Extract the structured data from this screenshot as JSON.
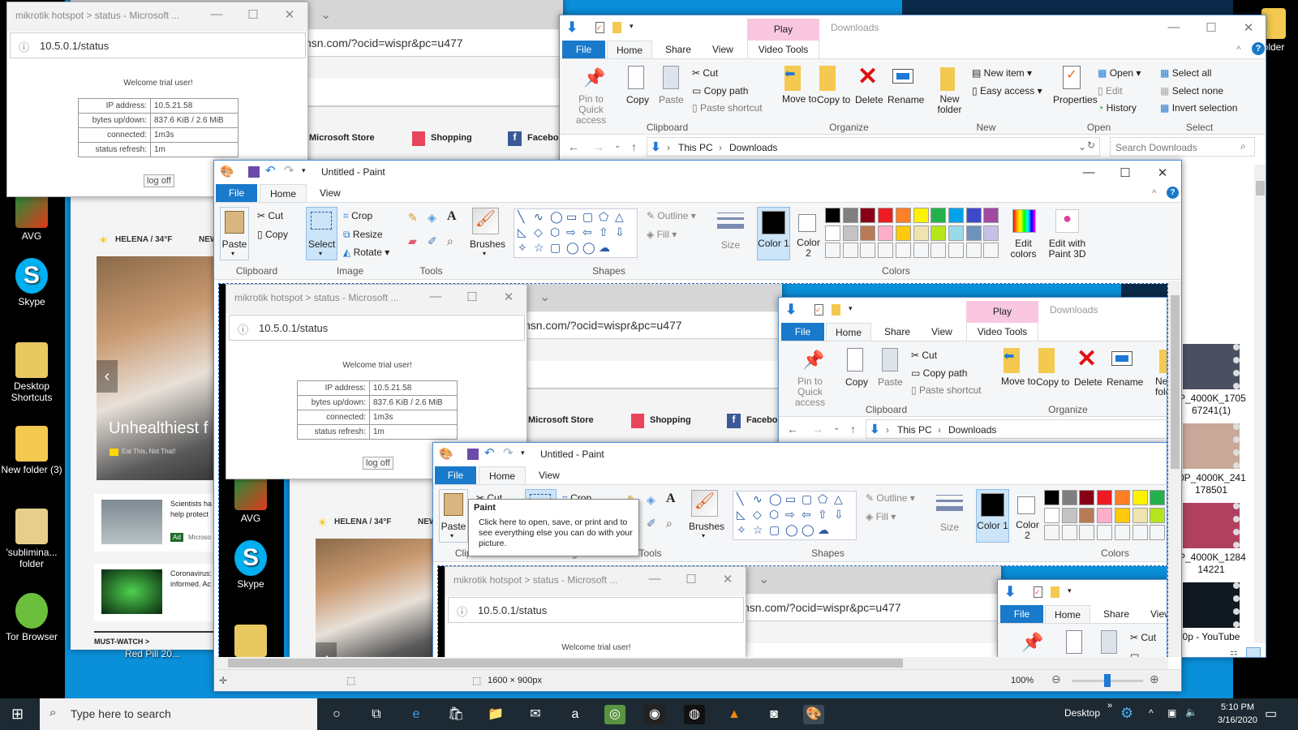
{
  "colors": {
    "desktop_blue": "#0a8fd9",
    "ribbon_file_blue": "#1979ca",
    "play_tab_pink": "#f9c8e0",
    "taskbar": "#1d2a33",
    "select_highlight": "#cce4f7"
  },
  "desktop": {
    "icons": [
      {
        "label": "AVG",
        "icon": "avg-icon"
      },
      {
        "label": "Skype",
        "icon": "skype-icon"
      },
      {
        "label": "Desktop Shortcuts",
        "icon": "shortcut-folder-icon"
      },
      {
        "label": "New folder (3)",
        "icon": "folder-icon"
      },
      {
        "label": "'sublimina... folder",
        "icon": "folder-icon"
      },
      {
        "label": "Tor Browser",
        "icon": "tor-icon"
      }
    ],
    "red_pill_label": "Red Pill 20...",
    "right_icon_label": "older"
  },
  "mikrotik": {
    "title": "mikrotik hotspot > status - Microsoft ...",
    "url": "10.5.0.1/status",
    "welcome": "Welcome trial user!",
    "rows": [
      [
        "IP address:",
        "10.5.21.58"
      ],
      [
        "bytes up/down:",
        "837.6 KiB / 2.6 MiB"
      ],
      [
        "connected:",
        "1m3s"
      ],
      [
        "status refresh:",
        "1m"
      ]
    ],
    "logoff": "log off"
  },
  "msn": {
    "url": "nsn.com/?ocid=wispr&pc=u477",
    "favorites": [
      "Microsoft Store",
      "Shopping",
      "Facebook"
    ],
    "weather": "HELENA / 34°F",
    "nav": "NEW",
    "hero_title": "Unhealthiest f",
    "hero_source": "Eat This, Not That!",
    "news": [
      {
        "line1": "Scientists ha",
        "line2": "help protect",
        "badge": "Ad",
        "source": "Microso"
      },
      {
        "line1": "Coronavirus:",
        "line2": "informed. Ac"
      }
    ],
    "must_watch": "MUST-WATCH >"
  },
  "explorer": {
    "title": "Downloads",
    "play_tab": "Play",
    "tabs": {
      "file": "File",
      "home": "Home",
      "share": "Share",
      "view": "View",
      "video_tools": "Video Tools"
    },
    "clipboard": {
      "pin": "Pin to Quick access",
      "copy": "Copy",
      "paste": "Paste",
      "cut": "Cut",
      "copy_path": "Copy path",
      "paste_shortcut": "Paste shortcut",
      "label": "Clipboard"
    },
    "organize": {
      "move_to": "Move to",
      "copy_to": "Copy to",
      "delete": "Delete",
      "rename": "Rename",
      "label": "Organize"
    },
    "new": {
      "new_folder": "New folder",
      "new_item": "New item",
      "easy_access": "Easy access",
      "label": "New"
    },
    "open": {
      "properties": "Properties",
      "open": "Open",
      "edit": "Edit",
      "history": "History",
      "label": "Open"
    },
    "select": {
      "all": "Select all",
      "none": "Select none",
      "invert": "Invert selection",
      "label": "Select"
    },
    "path": [
      "This PC",
      "Downloads"
    ],
    "search_placeholder": "Search Downloads",
    "files": [
      {
        "l1": "P_4000K_1705",
        "l2": "67241(1)"
      },
      {
        "l1": "0P_4000K_241",
        "l2": "178501"
      },
      {
        "l1": "P_4000K_1284",
        "l2": "14221"
      },
      {
        "l1": "0p - YouTube",
        "l2": ""
      }
    ]
  },
  "paint": {
    "title": "Untitled - Paint",
    "tabs": {
      "file": "File",
      "home": "Home",
      "view": "View"
    },
    "clipboard": {
      "paste": "Paste",
      "cut": "Cut",
      "copy": "Copy",
      "label": "Clipboard"
    },
    "image": {
      "select": "Select",
      "crop": "Crop",
      "resize": "Resize",
      "rotate": "Rotate",
      "label": "Image"
    },
    "tools_label": "Tools",
    "brushes": "Brushes",
    "shapes_label": "Shapes",
    "shape_glyphs": [
      "╲",
      "∿",
      "◯",
      "▭",
      "▢",
      "⬠",
      "△",
      "◺",
      "◇",
      "⬡",
      "⇨",
      "⇦",
      "⇧",
      "⇩",
      "✧",
      "☆",
      "▢",
      "◯",
      "◯",
      "☁"
    ],
    "outline": "Outline",
    "fill": "Fill",
    "size": "Size",
    "color1": "Color 1",
    "color2": "Color 2",
    "colors_label": "Colors",
    "edit_colors": "Edit colors",
    "paint3d": "Edit with Paint 3D",
    "palette": [
      "#000000",
      "#7f7f7f",
      "#880015",
      "#ed1c24",
      "#ff7f27",
      "#fff200",
      "#22b14c",
      "#00a2e8",
      "#3f48cc",
      "#a349a4",
      "#ffffff",
      "#c3c3c3",
      "#b97a57",
      "#ffaec9",
      "#ffc90e",
      "#efe4b0",
      "#b5e61d",
      "#99d9ea",
      "#7092be",
      "#c8bfe7"
    ],
    "status_size": "1600 × 900px",
    "zoom": "100%",
    "zoom_percent": 100
  },
  "tooltip": {
    "title": "Paint",
    "text": "Click here to open, save, or print and to see everything else you can do with your picture."
  },
  "taskbar": {
    "search_placeholder": "Type here to search",
    "apps": [
      "cortana",
      "task-view",
      "edge",
      "store",
      "file-explorer",
      "mail",
      "amazon",
      "tripadvisor",
      "webcam",
      "chrome-like",
      "vlc",
      "camera",
      "paint"
    ],
    "desktop_label": "Desktop",
    "time": "5:10 PM",
    "date": "3/16/2020"
  }
}
